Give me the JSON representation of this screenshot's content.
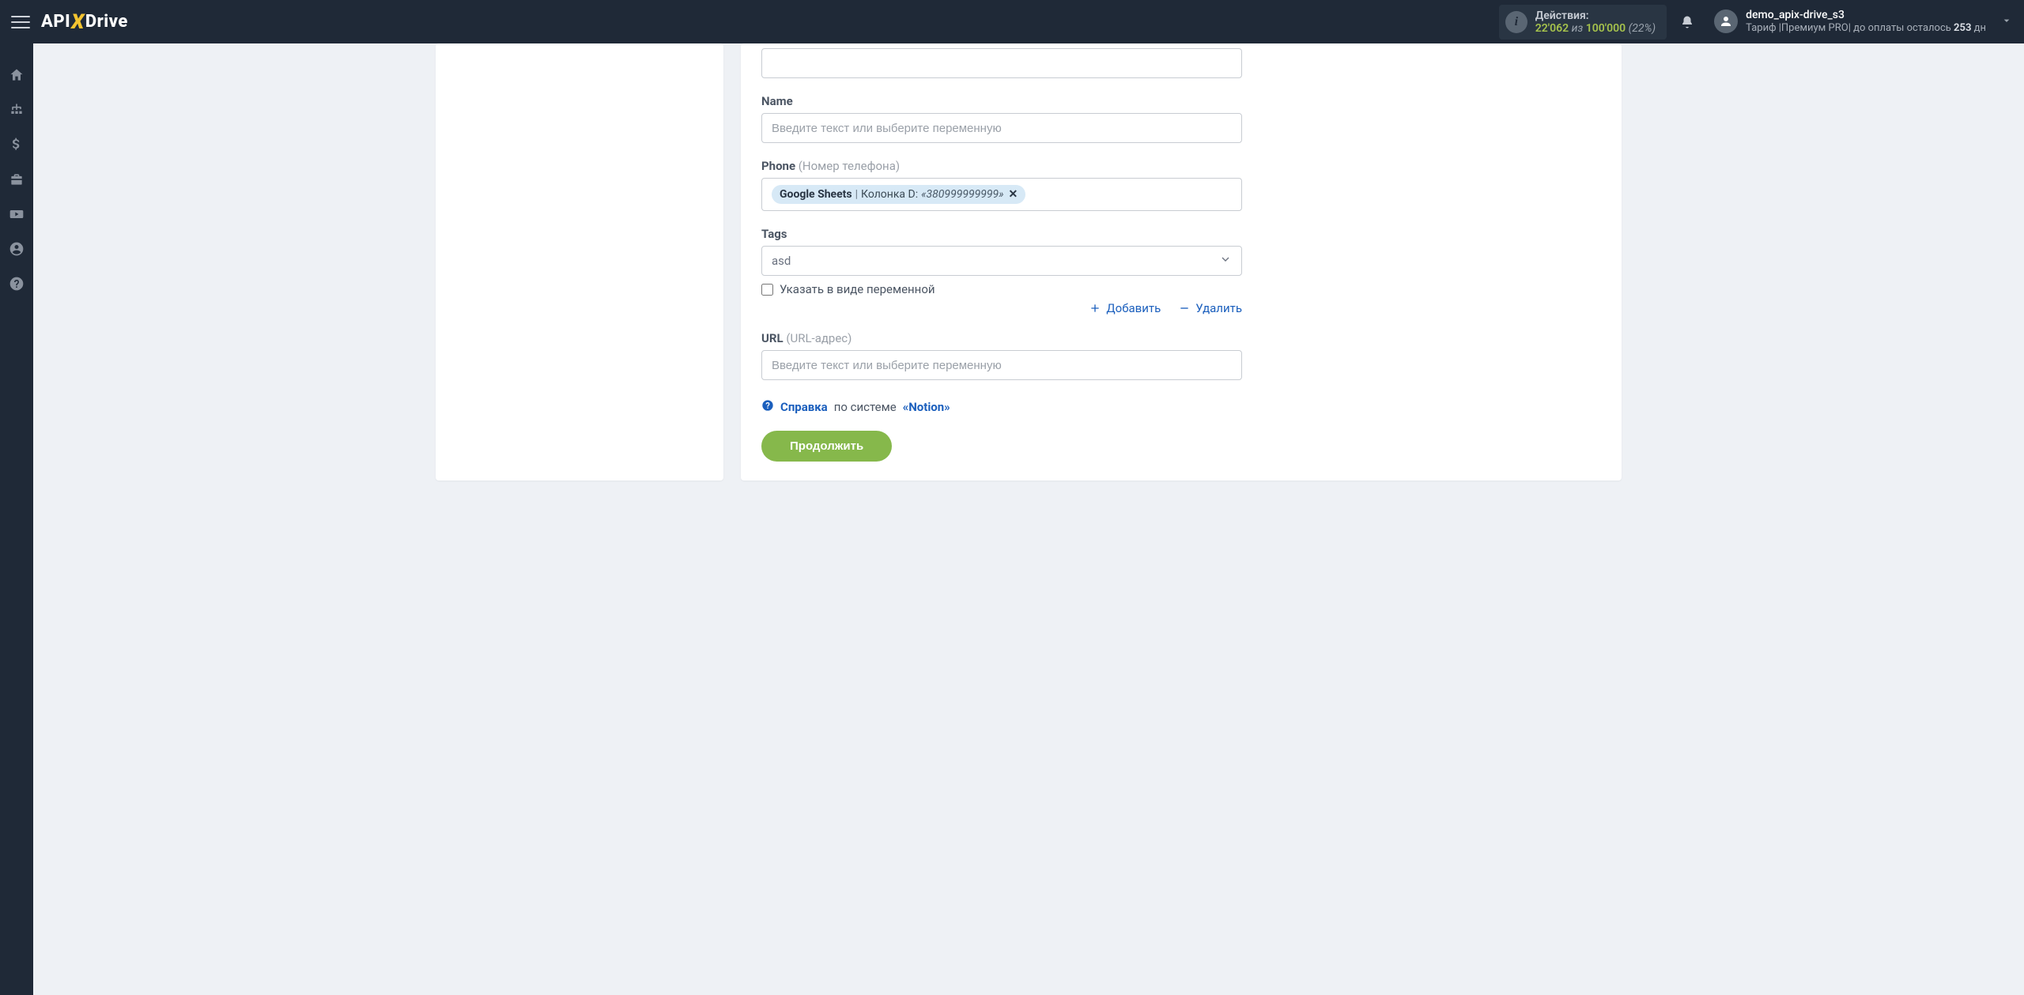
{
  "brand": {
    "pre": "API",
    "x": "X",
    "post": "Drive"
  },
  "header": {
    "actions_label": "Действия:",
    "used": "22'062",
    "of": "из",
    "total": "100'000",
    "pct": "(22%)",
    "user_name": "demo_apix-drive_s3",
    "plan_label": "Тариф |",
    "plan_name": "Премиум PRO",
    "pay_sep": "|",
    "pay_prefix": " до оплаты осталось ",
    "pay_days": "253",
    "pay_unit": " дн"
  },
  "rail": {
    "home": "home-icon",
    "connections": "sitemap-icon",
    "billing": "dollar-icon",
    "briefcase": "briefcase-icon",
    "videos": "youtube-icon",
    "account": "user-circle-icon",
    "help": "question-circle-icon"
  },
  "form": {
    "fields": {
      "top_value": "",
      "name": {
        "label": "Name",
        "placeholder": "Введите текст или выберите переменную"
      },
      "phone": {
        "label": "Phone",
        "hint": "(Номер телефона)",
        "pill_source": "Google Sheets",
        "pill_column_prefix": "Колонка D:",
        "pill_value": "«380999999999»"
      },
      "tags": {
        "label": "Tags",
        "selected": "asd",
        "as_variable_label": "Указать в виде переменной"
      },
      "url": {
        "label": "URL",
        "hint": "(URL-адрес)",
        "placeholder": "Введите текст или выберите переменную"
      }
    },
    "actions": {
      "add": "Добавить",
      "remove": "Удалить"
    },
    "help": {
      "link": "Справка",
      "mid": "по системе",
      "system": "«Notion»"
    },
    "continue": "Продолжить"
  }
}
